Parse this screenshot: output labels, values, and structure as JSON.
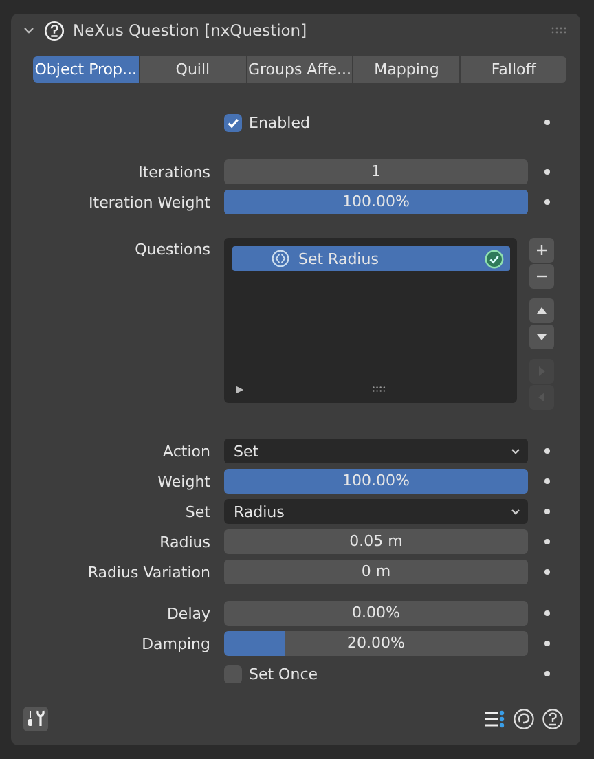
{
  "panel": {
    "title": "NeXus Question [nxQuestion]",
    "expanded": true
  },
  "tabs": [
    {
      "label": "Object Prop...",
      "selected": true
    },
    {
      "label": "Quill",
      "selected": false
    },
    {
      "label": "Groups Affe...",
      "selected": false
    },
    {
      "label": "Mapping",
      "selected": false
    },
    {
      "label": "Falloff",
      "selected": false
    }
  ],
  "sections": [
    [
      {
        "kind": "checkbox",
        "label": "Enabled",
        "checked": true,
        "animatable": true
      }
    ],
    [
      {
        "kind": "number",
        "label": "Iterations",
        "value": "1",
        "animatable": true
      },
      {
        "kind": "slider",
        "label": "Iteration Weight",
        "value": "100.00%",
        "level": 1,
        "animatable": true
      }
    ],
    [
      {
        "kind": "list",
        "label": "Questions",
        "items": [
          {
            "label": "Set Radius",
            "selected": true,
            "checked": true
          }
        ]
      }
    ],
    [
      {
        "kind": "dropdown",
        "label": "Action",
        "value": "Set",
        "animatable": true
      },
      {
        "kind": "slider",
        "label": "Weight",
        "value": "100.00%",
        "level": 1,
        "animatable": true
      },
      {
        "kind": "dropdown",
        "label": "Set",
        "value": "Radius",
        "animatable": true
      },
      {
        "kind": "number",
        "label": "Radius",
        "value": "0.05 m",
        "animatable": true
      },
      {
        "kind": "number",
        "label": "Radius Variation",
        "value": "0 m",
        "animatable": true
      }
    ],
    [
      {
        "kind": "slider",
        "label": "Delay",
        "value": "0.00%",
        "level": 0,
        "animatable": true
      },
      {
        "kind": "slider",
        "label": "Damping",
        "value": "20.00%",
        "level": 0.2,
        "animatable": true
      },
      {
        "kind": "checkbox",
        "label": "Set Once",
        "checked": false,
        "animatable": true
      }
    ]
  ]
}
